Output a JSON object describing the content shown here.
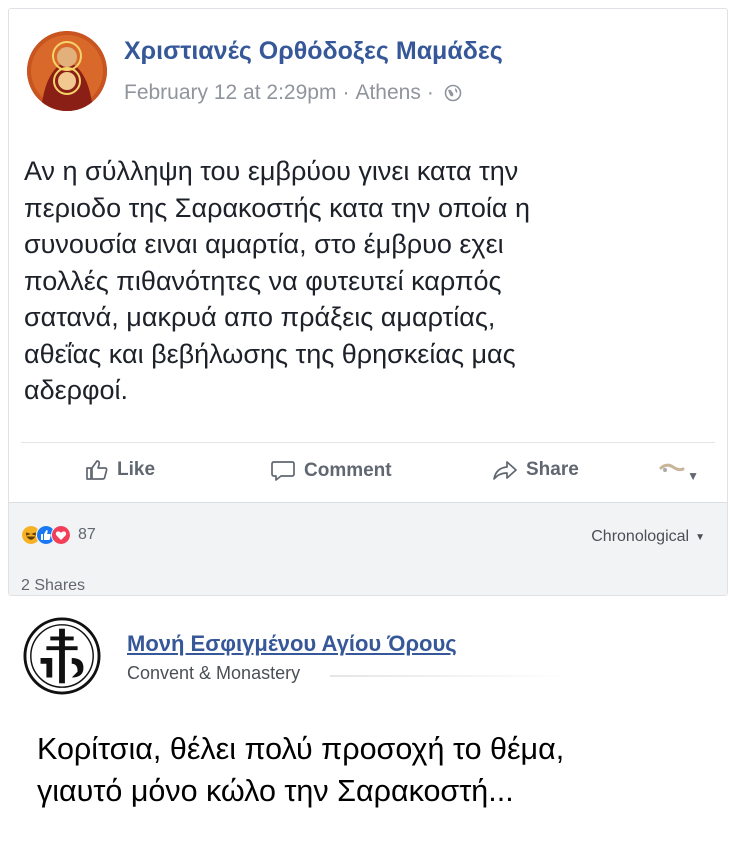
{
  "post": {
    "page_name": "Χριστιανές Ορθόδοξες Μαμάδες",
    "date": "February 12 at 2:29pm",
    "separator": "·",
    "location": "Athens",
    "text_lines": [
      "Αν η σύλληψη του εμβρύου γινει κατα την",
      "περιοδο της Σαρακοστής κατα την οποία η",
      "συνουσία ειναι αμαρτία, στο έμβρυο εχει",
      "πολλές πιθανότητες να φυτευτεί καρπός",
      "σατανά, μακρυά απο πράξεις  αμαρτίας,",
      "αθεΐας και βεβήλωσης της θρησκείας μας",
      "αδερφοί."
    ]
  },
  "actions": {
    "like": "Like",
    "comment": "Comment",
    "share": "Share"
  },
  "reactions": {
    "count": "87",
    "icons": [
      "haha-icon",
      "like-icon",
      "love-icon"
    ],
    "colors": {
      "haha": "#f7b125",
      "like": "#1877f2",
      "love": "#f33e58"
    }
  },
  "sort": {
    "label": "Chronological",
    "caret": "▼"
  },
  "shares": "2 Shares",
  "comment_card": {
    "name": "Μονή Εσφιγμένου Αγίου Όρους",
    "category": "Convent & Monastery"
  },
  "caption": {
    "line1": "Κορίτσια, θέλει πολύ προσοχή το θέμα,",
    "line2": "γιαυτό μόνο κώλο την Σαρακοστή..."
  },
  "colors": {
    "link": "#365899",
    "meta": "#90949c",
    "text": "#1d2129"
  }
}
